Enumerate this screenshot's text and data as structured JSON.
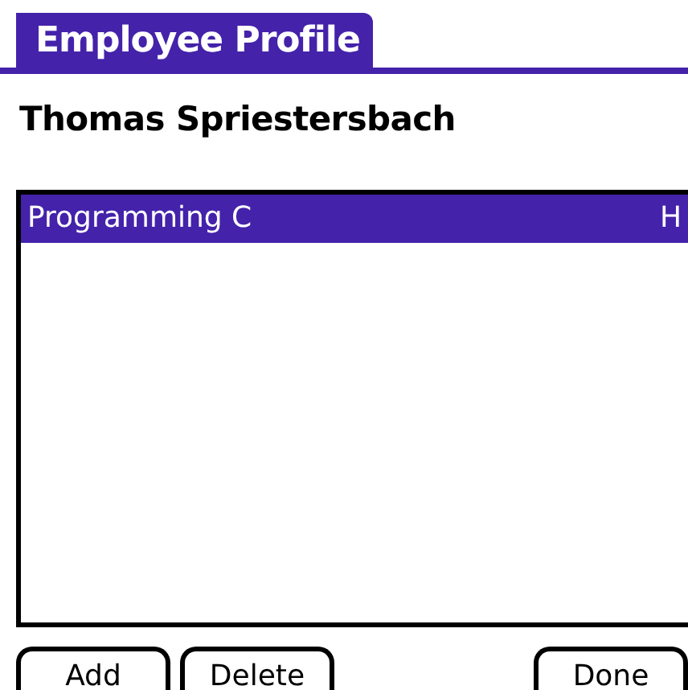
{
  "window": {
    "title": "Employee Profile"
  },
  "employee": {
    "name": "Thomas Spriestersbach"
  },
  "skills": [
    {
      "name": "Programming C",
      "column_2": "H",
      "selected": true
    }
  ],
  "left_buttons": [
    "Add",
    "Delete"
  ],
  "right_buttons": [
    "Done"
  ]
}
